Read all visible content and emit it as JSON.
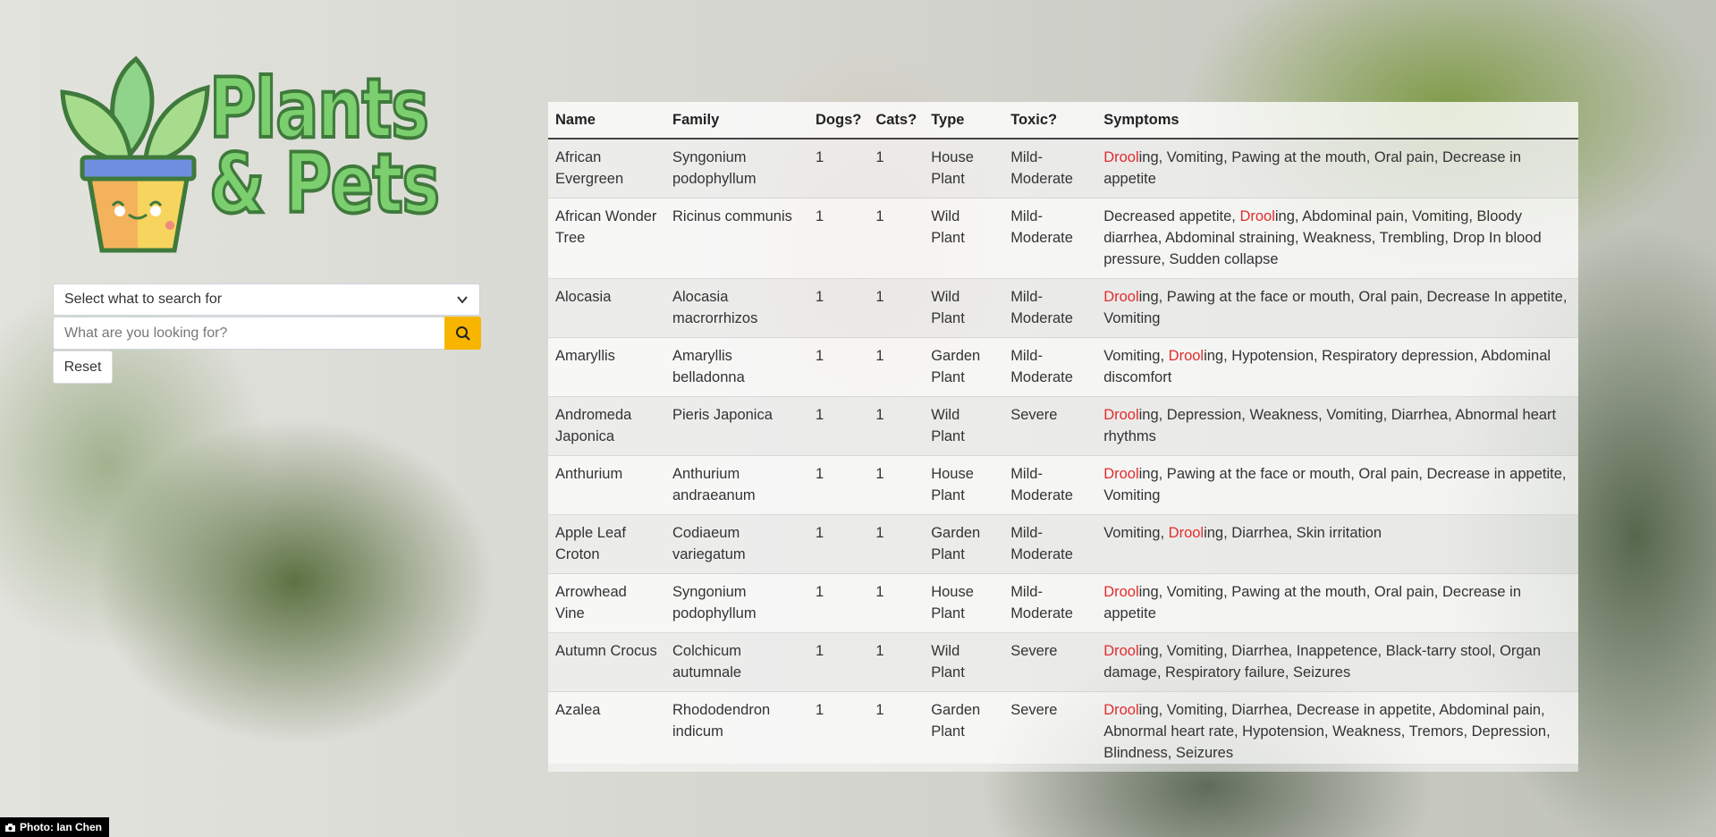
{
  "logo": {
    "line1": "Plants",
    "line2": "& Pets"
  },
  "search": {
    "select_label": "Select what to search for",
    "placeholder": "What are you looking for?",
    "reset_label": "Reset"
  },
  "table": {
    "headers": [
      "Name",
      "Family",
      "Dogs?",
      "Cats?",
      "Type",
      "Toxic?",
      "Symptoms"
    ],
    "rows": [
      {
        "name": "African Evergreen",
        "family": "Syngonium podophyllum",
        "dogs": "1",
        "cats": "1",
        "type": "House Plant",
        "toxic": "Mild-Moderate",
        "symptoms_before": "",
        "symptoms_highlight": "Drool",
        "symptoms_after": "ing, Vomiting, Pawing at the mouth, Oral pain, Decrease in appetite"
      },
      {
        "name": "African Wonder Tree",
        "family": "Ricinus communis",
        "dogs": "1",
        "cats": "1",
        "type": "Wild Plant",
        "toxic": "Mild-Moderate",
        "symptoms_before": "Decreased appetite, ",
        "symptoms_highlight": "Drool",
        "symptoms_after": "ing, Abdominal pain, Vomiting, Bloody diarrhea, Abdominal straining, Weakness, Trembling, Drop In blood pressure, Sudden collapse"
      },
      {
        "name": "Alocasia",
        "family": "Alocasia macrorrhizos",
        "dogs": "1",
        "cats": "1",
        "type": "Wild Plant",
        "toxic": "Mild-Moderate",
        "symptoms_before": "",
        "symptoms_highlight": "Drool",
        "symptoms_after": "ing, Pawing at the face or mouth, Oral pain, Decrease In appetite, Vomiting"
      },
      {
        "name": "Amaryllis",
        "family": "Amaryllis belladonna",
        "dogs": "1",
        "cats": "1",
        "type": "Garden Plant",
        "toxic": "Mild-Moderate",
        "symptoms_before": "Vomiting, ",
        "symptoms_highlight": "Drool",
        "symptoms_after": "ing, Hypotension, Respiratory depression, Abdominal discomfort"
      },
      {
        "name": "Andromeda Japonica",
        "family": "Pieris Japonica",
        "dogs": "1",
        "cats": "1",
        "type": "Wild Plant",
        "toxic": "Severe",
        "symptoms_before": "",
        "symptoms_highlight": "Drool",
        "symptoms_after": "ing, Depression, Weakness, Vomiting, Diarrhea, Abnormal heart rhythms"
      },
      {
        "name": "Anthurium",
        "family": "Anthurium andraeanum",
        "dogs": "1",
        "cats": "1",
        "type": "House Plant",
        "toxic": "Mild-Moderate",
        "symptoms_before": "",
        "symptoms_highlight": "Drool",
        "symptoms_after": "ing, Pawing at the face or mouth, Oral pain, Decrease in appetite, Vomiting"
      },
      {
        "name": "Apple Leaf Croton",
        "family": "Codiaeum variegatum",
        "dogs": "1",
        "cats": "1",
        "type": "Garden Plant",
        "toxic": "Mild-Moderate",
        "symptoms_before": "Vomiting, ",
        "symptoms_highlight": "Drool",
        "symptoms_after": "ing, Diarrhea, Skin irritation"
      },
      {
        "name": "Arrowhead Vine",
        "family": "Syngonium podophyllum",
        "dogs": "1",
        "cats": "1",
        "type": "House Plant",
        "toxic": "Mild-Moderate",
        "symptoms_before": "",
        "symptoms_highlight": "Drool",
        "symptoms_after": "ing, Vomiting, Pawing at the mouth, Oral pain, Decrease in appetite"
      },
      {
        "name": "Autumn Crocus",
        "family": "Colchicum autumnale",
        "dogs": "1",
        "cats": "1",
        "type": "Wild Plant",
        "toxic": "Severe",
        "symptoms_before": "",
        "symptoms_highlight": "Drool",
        "symptoms_after": "ing, Vomiting, Diarrhea, Inappetence, Black-tarry stool, Organ damage, Respiratory failure, Seizures"
      },
      {
        "name": "Azalea",
        "family": "Rhododendron indicum",
        "dogs": "1",
        "cats": "1",
        "type": "Garden Plant",
        "toxic": "Severe",
        "symptoms_before": "",
        "symptoms_highlight": "Drool",
        "symptoms_after": "ing, Vomiting, Diarrhea, Decrease in appetite, Abdominal pain, Abnormal heart rate, Hypotension, Weakness, Tremors, Depression, Blindness, Seizures"
      }
    ]
  },
  "credit": {
    "label": "Photo: Ian Chen"
  },
  "colors": {
    "accent": "#f7b500",
    "highlight": "#e12d2d",
    "logo_green": "#7ccf6e"
  }
}
